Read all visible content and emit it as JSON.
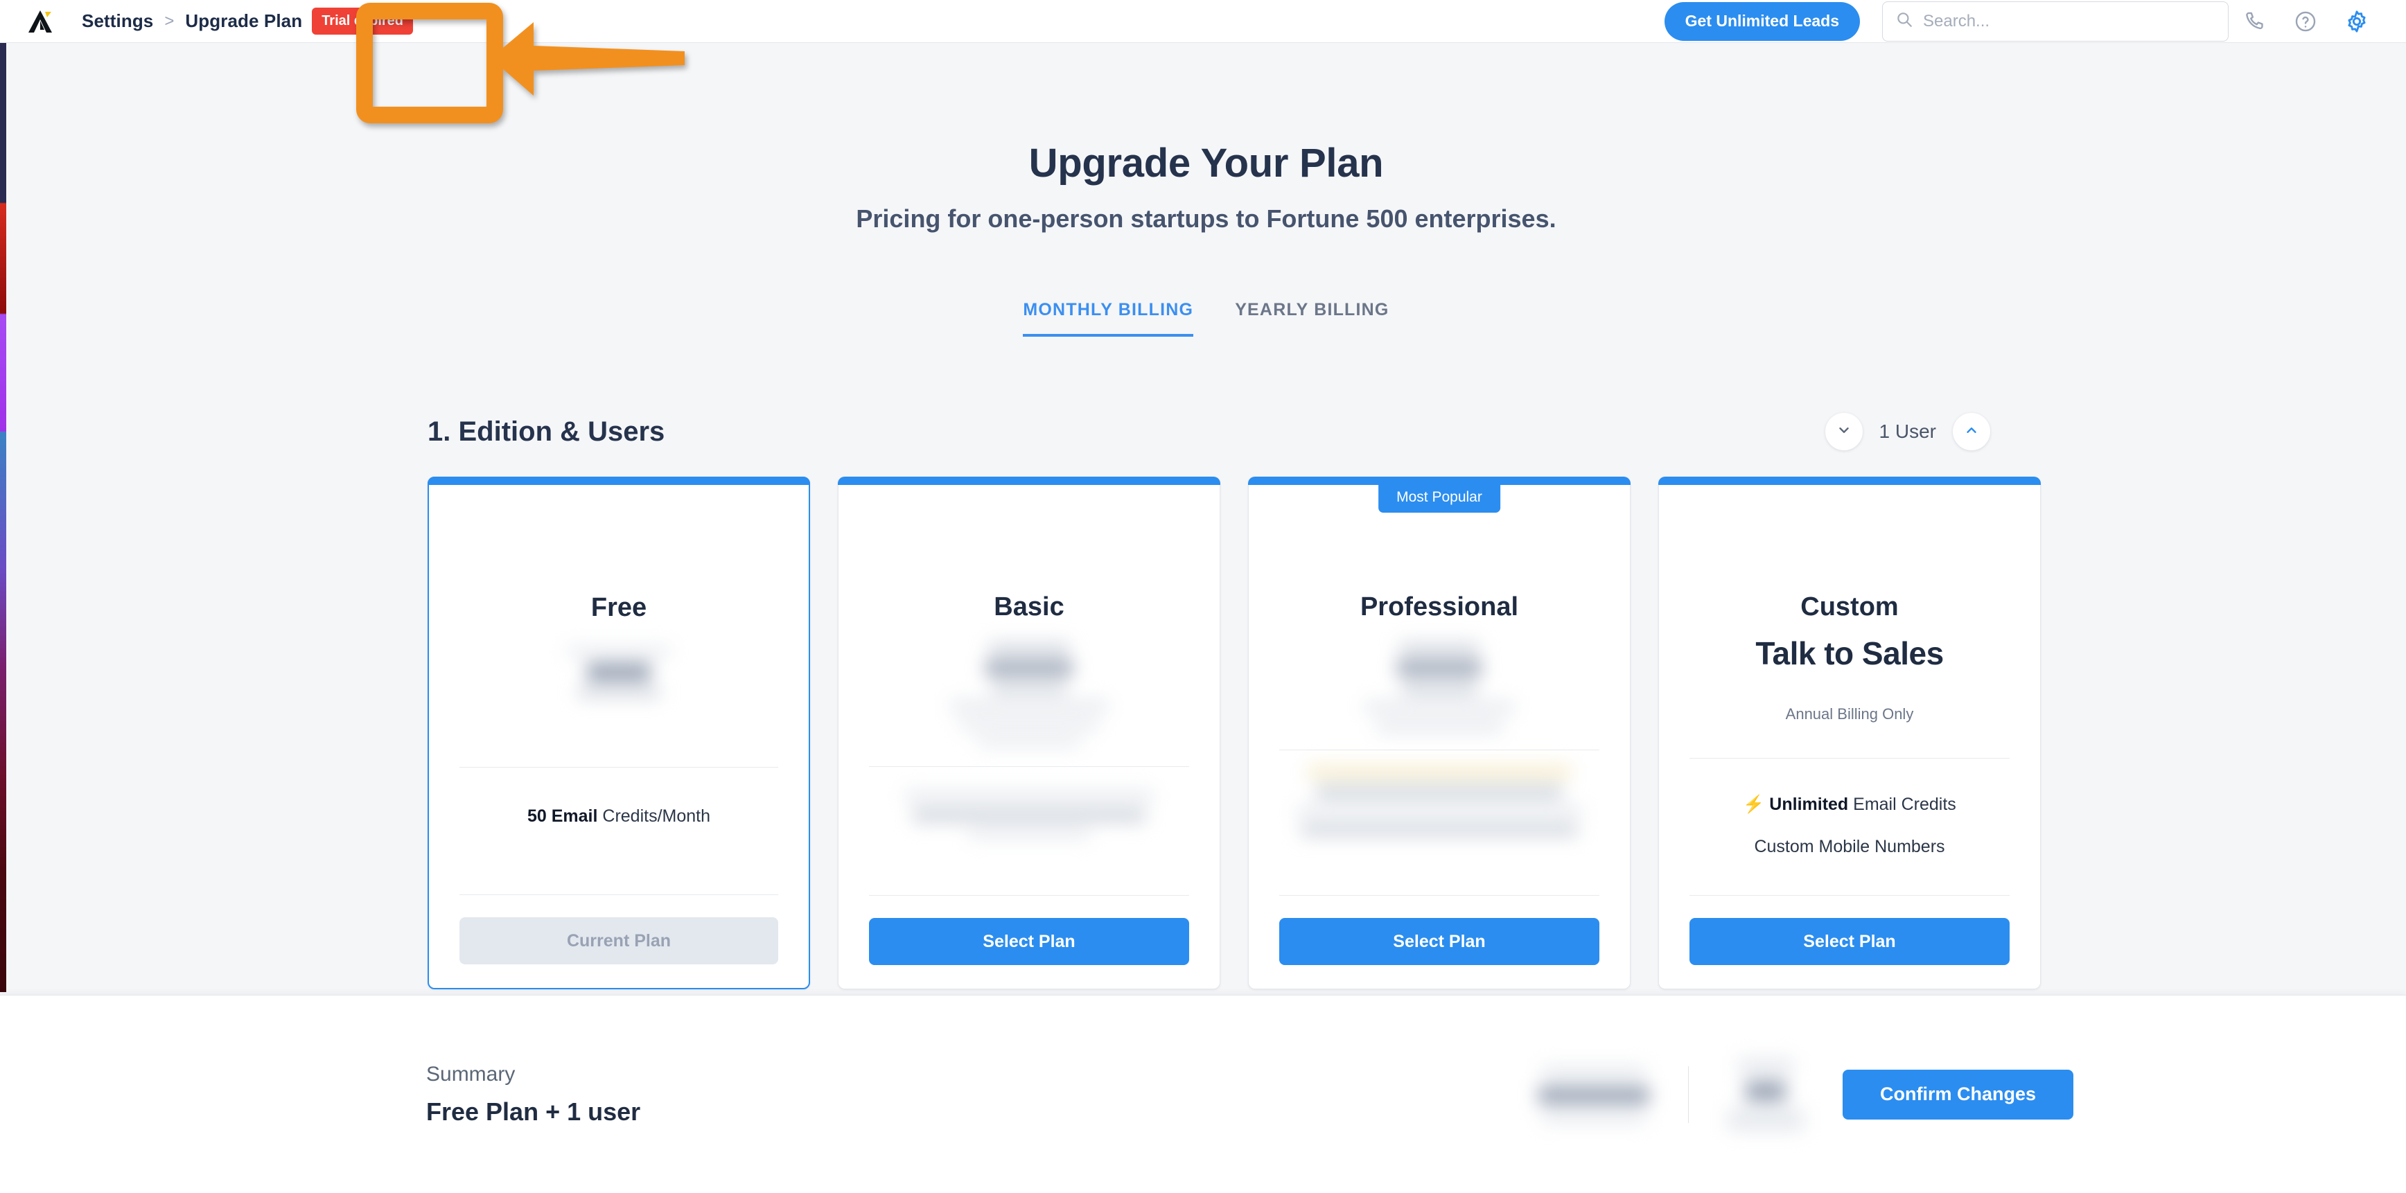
{
  "topbar": {
    "logo_name": "apollo-logo",
    "breadcrumb": [
      "Settings",
      "Upgrade Plan"
    ],
    "breadcrumb_separator": ">",
    "trial_badge": "Trial expired",
    "unlimited_leads_button": "Get Unlimited Leads",
    "search_placeholder": "Search...",
    "search_value": "",
    "icons": [
      "phone-icon",
      "help-icon",
      "gear-icon"
    ]
  },
  "main": {
    "title": "Upgrade Your Plan",
    "subtitle": "Pricing for one-person startups to Fortune 500 enterprises.",
    "tabs": [
      {
        "label": "MONTHLY BILLING",
        "active": true
      },
      {
        "label": "YEARLY BILLING",
        "active": false
      }
    ],
    "section_title": "1. Edition & Users",
    "user_stepper": {
      "decrement_icon": "chevron-down-icon",
      "value": "1 User",
      "increment_icon": "chevron-up-icon"
    },
    "plans": [
      {
        "name": "Free",
        "headline": "",
        "note": "",
        "badge": "",
        "selected": true,
        "price_censored": true,
        "features": [
          "50 Email Credits/Month"
        ],
        "features_censored": false,
        "cta_label": "Current Plan",
        "cta_state": "disabled"
      },
      {
        "name": "Basic",
        "headline": "",
        "note": "",
        "badge": "",
        "selected": false,
        "price_censored": true,
        "features": [],
        "features_censored": true,
        "cta_label": "Select Plan",
        "cta_state": "primary"
      },
      {
        "name": "Professional",
        "headline": "",
        "note": "",
        "badge": "Most Popular",
        "selected": false,
        "price_censored": true,
        "features": [],
        "features_censored": true,
        "cta_label": "Select Plan",
        "cta_state": "primary"
      },
      {
        "name": "Custom",
        "headline": "Talk to Sales",
        "note": "Annual Billing Only",
        "badge": "",
        "selected": false,
        "price_censored": false,
        "features": [
          "Unlimited Email Credits",
          "Custom Mobile Numbers"
        ],
        "features_censored": false,
        "cta_label": "Select Plan",
        "cta_state": "primary"
      }
    ]
  },
  "summary": {
    "label": "Summary",
    "value": "Free Plan + 1 user",
    "price_censored": true,
    "confirm_button": "Confirm Changes"
  },
  "annotation": {
    "type": "highlight-box-with-arrow",
    "target": "trial-expired-badge",
    "color": "#f2901f"
  },
  "colors": {
    "accent_blue": "#2b8def",
    "danger_red": "#ef4136",
    "annotation_orange": "#f2901f",
    "page_bg": "#f5f6f8"
  }
}
